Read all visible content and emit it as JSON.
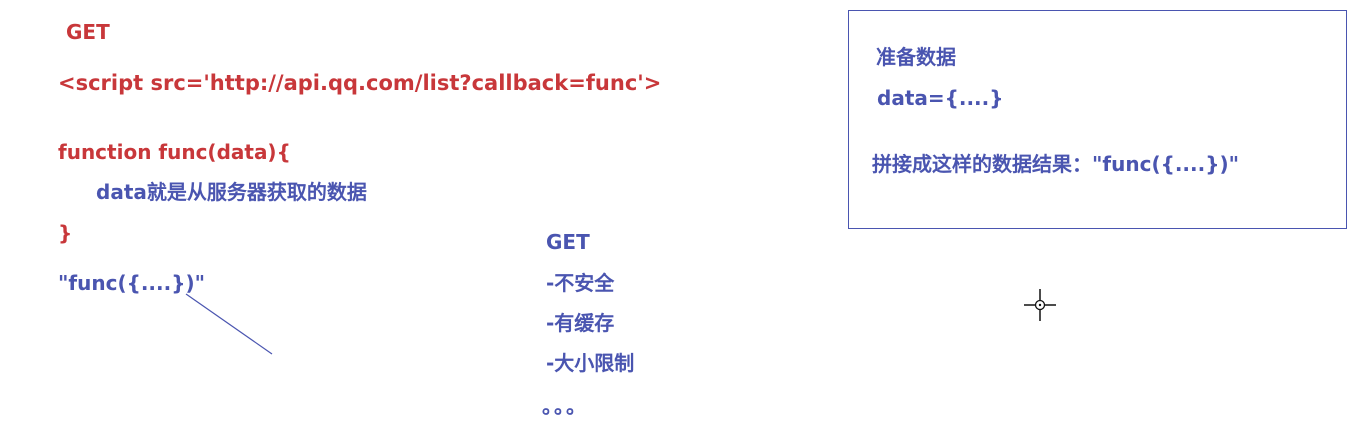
{
  "left": {
    "method": "GET",
    "script_tag": "<script  src='http://api.qq.com/list?callback=func'>",
    "func_open": "function func(data){",
    "func_body": "data就是从服务器获取的数据",
    "func_close": "}",
    "call_string": "\"func({....})\""
  },
  "middle": {
    "title": "GET",
    "items": [
      "-不安全",
      "-有缓存",
      "-大小限制"
    ],
    "ellipsis": "。。。"
  },
  "server_box": {
    "line1": "准备数据",
    "line2": "data={....}",
    "line3": "拼接成这样的数据结果：\"func({....})\""
  },
  "colors": {
    "red": "#c8373a",
    "blue": "#4a55b0"
  },
  "icons": {
    "cursor": "crosshair-move-cursor-icon"
  }
}
